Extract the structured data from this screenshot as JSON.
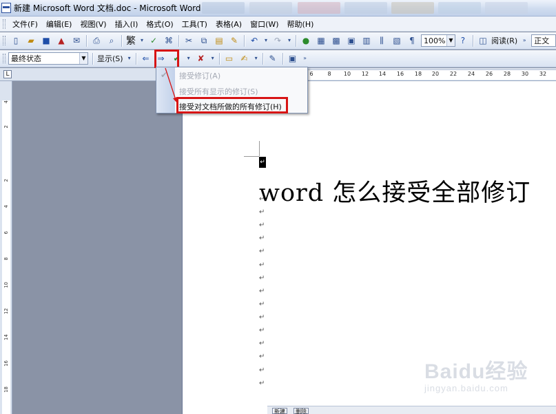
{
  "window": {
    "title": "新建 Microsoft Word 文档.doc - Microsoft Word"
  },
  "menubar": {
    "items": [
      "文件(F)",
      "编辑(E)",
      "视图(V)",
      "插入(I)",
      "格式(O)",
      "工具(T)",
      "表格(A)",
      "窗口(W)",
      "帮助(H)"
    ]
  },
  "toolbar_standard": {
    "traditional_label": "繁",
    "zoom_value": "100%",
    "read_label": "阅读(R)",
    "style_value": "正文"
  },
  "toolbar_review": {
    "view_mode_value": "最终状态",
    "show_label": "显示(S)"
  },
  "accept_menu": {
    "items": [
      {
        "label": "接受修订(A)",
        "enabled": false
      },
      {
        "label": "接受所有显示的修订(S)",
        "enabled": false
      },
      {
        "label": "接受对文档所做的所有修订(H)",
        "enabled": true
      }
    ]
  },
  "ruler": {
    "corner_label": "L",
    "h_ticks": [
      "6",
      "8",
      "10",
      "12",
      "14",
      "16",
      "18",
      "20",
      "22",
      "24",
      "26",
      "28",
      "30",
      "32"
    ],
    "v_ticks": [
      "4",
      "2",
      "2",
      "4",
      "6",
      "8",
      "10",
      "12",
      "14",
      "16",
      "18"
    ]
  },
  "document": {
    "heading": "word 怎么接受全部修订",
    "paragraph_mark": "↵"
  },
  "statusbar": {
    "new_label": "新建",
    "delete_label": "删除"
  },
  "watermark": {
    "logo": "Baidu经验",
    "sub": "jingyan.baidu.com"
  },
  "colors": {
    "highlight": "#d71414",
    "workspace": "#8a93a6"
  }
}
